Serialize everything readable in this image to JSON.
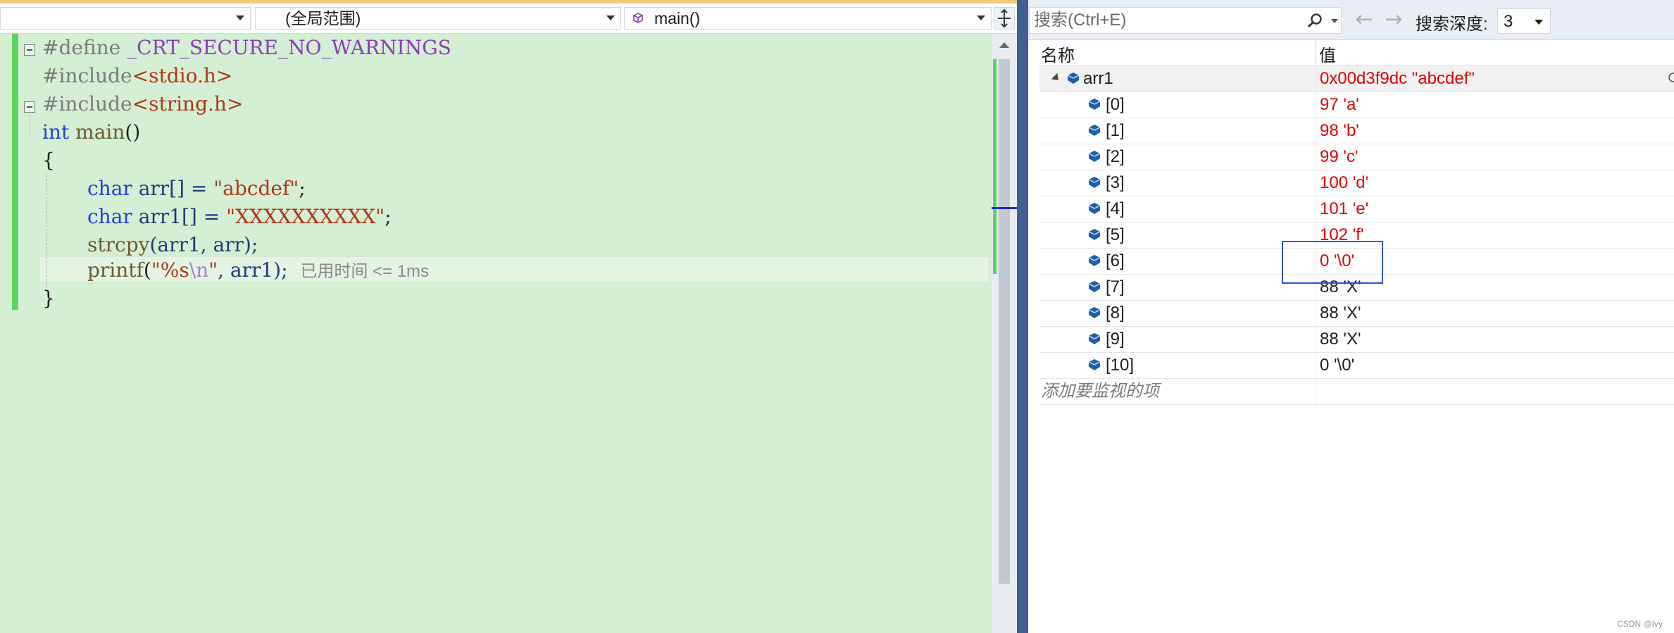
{
  "navbar": {
    "project_value": "",
    "scope_value": "(全局范围)",
    "function_value": "main()"
  },
  "code": {
    "line1": {
      "directive": "#define",
      "macro": "_CRT_SECURE_NO_WARNINGS"
    },
    "line2": {
      "directive": "#include",
      "header": "<stdio.h>"
    },
    "line3": {
      "directive": "#include",
      "header": "<string.h>"
    },
    "line4": {
      "type": "int",
      "name": "main",
      "rest": "()"
    },
    "line5": "{",
    "line6": {
      "type": "char",
      "rest": "arr[] = ",
      "literal": "\"abcdef\"",
      "end": ";"
    },
    "line7": {
      "type": "char",
      "rest": "arr1[] = ",
      "literal": "\"XXXXXXXXXX\"",
      "end": ";"
    },
    "line8": {
      "fn": "strcpy",
      "args": "(arr1, arr);"
    },
    "line9": {
      "fn": "printf",
      "open": "(",
      "lit_a": "\"%s",
      "esc": "\\n",
      "lit_b": "\"",
      "rest": ", arr1);",
      "perf_hint": "已用时间 <= 1ms"
    },
    "line10": "}"
  },
  "watch": {
    "search_placeholder": "搜索(Ctrl+E)",
    "back_icon": "←",
    "forward_icon": "→",
    "depth_label": "搜索深度:",
    "depth_value": "3",
    "col_name": "名称",
    "col_value": "值",
    "rows": [
      {
        "name": "arr1",
        "value": "0x00d3f9dc \"abcdef\"",
        "changed": true
      },
      {
        "name": "[0]",
        "value": "97 'a'",
        "changed": true
      },
      {
        "name": "[1]",
        "value": "98 'b'",
        "changed": true
      },
      {
        "name": "[2]",
        "value": "99 'c'",
        "changed": true
      },
      {
        "name": "[3]",
        "value": "100 'd'",
        "changed": true
      },
      {
        "name": "[4]",
        "value": "101 'e'",
        "changed": true
      },
      {
        "name": "[5]",
        "value": "102 'f'",
        "changed": true
      },
      {
        "name": "[6]",
        "value": "0 '\\0'",
        "changed": true
      },
      {
        "name": "[7]",
        "value": "88 'X'",
        "changed": false
      },
      {
        "name": "[8]",
        "value": "88 'X'",
        "changed": false
      },
      {
        "name": "[9]",
        "value": "88 'X'",
        "changed": false
      },
      {
        "name": "[10]",
        "value": "0 '\\0'",
        "changed": false
      }
    ],
    "add_watch_text": "添加要监视的项"
  },
  "colors": {
    "editor_bg": "#d4efd4",
    "changed_value": "#e00000",
    "highlight_box": "#2a56d6",
    "keyword": "#2340d8",
    "string": "#b0361a"
  },
  "watermark": "CSDN @Ivy"
}
